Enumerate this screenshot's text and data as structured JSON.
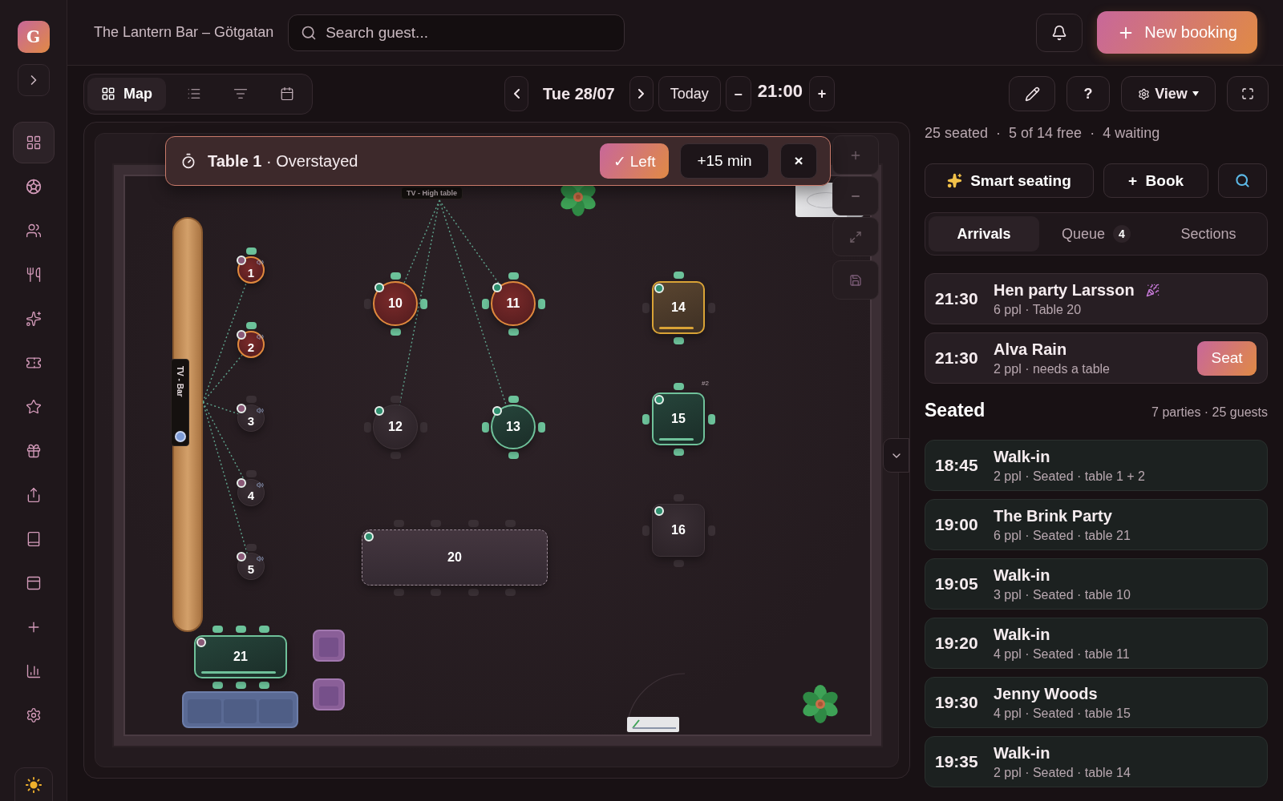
{
  "sidebar": {
    "avatar": "G",
    "items": [
      {
        "selected": true
      },
      {
        "selected": false
      },
      {
        "selected": false
      },
      {
        "selected": false
      },
      {
        "selected": false
      },
      {
        "selected": false
      },
      {
        "selected": false
      },
      {
        "selected": false
      },
      {
        "selected": false
      },
      {
        "selected": false
      },
      {
        "selected": false
      },
      {
        "selected": false
      },
      {
        "selected": false
      },
      {
        "selected": false
      }
    ]
  },
  "header": {
    "venue": "The Lantern Bar – Götgatan",
    "search": {
      "placeholder": "Search guest..."
    },
    "new_booking": "New booking"
  },
  "view_tabs": [
    {
      "label": "Map",
      "selected": true
    },
    {
      "selected": false
    },
    {
      "selected": false
    },
    {
      "selected": false
    }
  ],
  "date_nav": {
    "date": "Tue 28/07",
    "today": "Today",
    "minus": "–",
    "time": "21:00",
    "plus": "+"
  },
  "toolbar": {
    "help": "?",
    "view": "View"
  },
  "toast": {
    "message": "**Table 1** · Overstayed",
    "actions": [
      {
        "label": "✓ Left",
        "kind": "primary"
      },
      {
        "label": "+15 min",
        "kind": "secondary"
      },
      {
        "label": "×",
        "kind": "close"
      }
    ]
  },
  "floor": {
    "tv_labels": [
      {
        "label": "TV - Bar",
        "kind": "bar"
      },
      {
        "label": "TV - High table",
        "kind": "high"
      }
    ],
    "tables": [
      {
        "label": "1",
        "kind": "stool",
        "overstayed": true,
        "warning": false,
        "reserved": false,
        "color": "#8a5a78",
        "chairs": [
          {
            "occupied": true
          }
        ]
      },
      {
        "label": "2",
        "kind": "stool",
        "overstayed": true,
        "warning": false,
        "reserved": false,
        "color": "#8a5a78",
        "chairs": [
          {
            "occupied": true
          }
        ]
      },
      {
        "label": "3",
        "kind": "stool",
        "overstayed": false,
        "warning": false,
        "reserved": false,
        "color": "#8a5a78",
        "chairs": [
          {
            "occupied": false
          }
        ]
      },
      {
        "label": "4",
        "kind": "stool",
        "overstayed": false,
        "warning": false,
        "reserved": false,
        "color": "#8a5a78",
        "chairs": [
          {
            "occupied": false
          }
        ]
      },
      {
        "label": "5",
        "kind": "stool",
        "overstayed": false,
        "warning": false,
        "reserved": false,
        "color": "#8a5a78",
        "chairs": [
          {
            "occupied": false
          }
        ]
      },
      {
        "label": "10",
        "kind": "round",
        "overstayed": true,
        "warning": false,
        "reserved": false,
        "color": "#2f8f6f",
        "chairs": [
          {
            "occupied": true
          },
          {
            "occupied": true
          },
          {
            "occupied": true
          },
          {
            "occupied": false
          }
        ]
      },
      {
        "label": "11",
        "kind": "round",
        "overstayed": true,
        "warning": false,
        "reserved": false,
        "color": "#2f8f6f",
        "chairs": [
          {
            "occupied": true
          },
          {
            "occupied": true
          },
          {
            "occupied": true
          },
          {
            "occupied": true
          }
        ]
      },
      {
        "label": "12",
        "kind": "round",
        "overstayed": false,
        "warning": false,
        "reserved": false,
        "color": "#2f8f6f",
        "chairs": [
          {
            "occupied": false
          },
          {
            "occupied": false
          },
          {
            "occupied": false
          },
          {
            "occupied": false
          }
        ]
      },
      {
        "label": "13",
        "kind": "round",
        "overstayed": false,
        "warning": false,
        "reserved": false,
        "color": "#2f8f6f",
        "chairs": [
          {
            "occupied": true
          },
          {
            "occupied": true
          },
          {
            "occupied": true
          },
          {
            "occupied": true
          }
        ]
      },
      {
        "label": "14",
        "kind": "square",
        "overstayed": false,
        "warning": true,
        "reserved": false,
        "color": "#2f8f6f",
        "chairs": [
          {
            "occupied": true
          },
          {
            "occupied": false
          },
          {
            "occupied": true
          },
          {
            "occupied": false
          }
        ]
      },
      {
        "label": "15",
        "kind": "square",
        "overstayed": false,
        "warning": false,
        "reserved": false,
        "color": "#2f8f6f",
        "tag": "#2",
        "chairs": [
          {
            "occupied": true
          },
          {
            "occupied": true
          },
          {
            "occupied": true
          },
          {
            "occupied": true
          }
        ]
      },
      {
        "label": "16",
        "kind": "square",
        "overstayed": false,
        "warning": false,
        "reserved": false,
        "color": "#2f8f6f",
        "chairs": [
          {
            "occupied": false
          },
          {
            "occupied": false
          },
          {
            "occupied": false
          },
          {
            "occupied": false
          }
        ]
      },
      {
        "label": "20",
        "kind": "long",
        "overstayed": false,
        "warning": false,
        "reserved": true,
        "color": "#2f8f6f",
        "chairs": [
          {
            "occupied": false
          },
          {
            "occupied": false
          },
          {
            "occupied": false
          },
          {
            "occupied": false
          },
          {
            "occupied": false
          },
          {
            "occupied": false
          },
          {
            "occupied": false
          },
          {
            "occupied": false
          }
        ]
      },
      {
        "label": "21",
        "kind": "long",
        "overstayed": false,
        "warning": false,
        "reserved": false,
        "color": "#8a5a78",
        "chairs": [
          {
            "occupied": true
          },
          {
            "occupied": true
          },
          {
            "occupied": true
          },
          {
            "occupied": true
          },
          {
            "occupied": true
          },
          {
            "occupied": true
          }
        ]
      }
    ]
  },
  "summary": "25 seated  ·  5 of 14 free  ·  4 waiting",
  "actions": [
    {
      "label": "Smart seating",
      "kind": "smart"
    },
    {
      "label": "+  Book",
      "kind": "book"
    },
    {
      "kind": "search"
    }
  ],
  "tabs": [
    {
      "label": "Arrivals",
      "selected": true
    },
    {
      "label": "Queue",
      "badge": "4",
      "selected": false
    },
    {
      "label": "Sections",
      "selected": false
    }
  ],
  "arrivals": [
    {
      "time": "21:30",
      "name": "Hen party Larsson",
      "detail": "6 ppl · Table 20",
      "kind": "party"
    },
    {
      "time": "21:30",
      "name": "Alva Rain",
      "detail": "2 ppl · needs a table",
      "kind": "waiting",
      "action": "Seat"
    }
  ],
  "seated": {
    "title": "Seated",
    "summary": "7 parties · 25 guests",
    "rows": [
      {
        "time": "18:45",
        "name": "Walk-in",
        "detail": "2 ppl · Seated · table 1 + 2"
      },
      {
        "time": "19:00",
        "name": "The Brink Party",
        "detail": "6 ppl · Seated · table 21"
      },
      {
        "time": "19:05",
        "name": "Walk-in",
        "detail": "3 ppl · Seated · table 10"
      },
      {
        "time": "19:20",
        "name": "Walk-in",
        "detail": "4 ppl · Seated · table 11"
      },
      {
        "time": "19:30",
        "name": "Jenny Woods",
        "detail": "4 ppl · Seated · table 15"
      },
      {
        "time": "19:35",
        "name": "Walk-in",
        "detail": "2 ppl · Seated · table 14"
      }
    ]
  }
}
